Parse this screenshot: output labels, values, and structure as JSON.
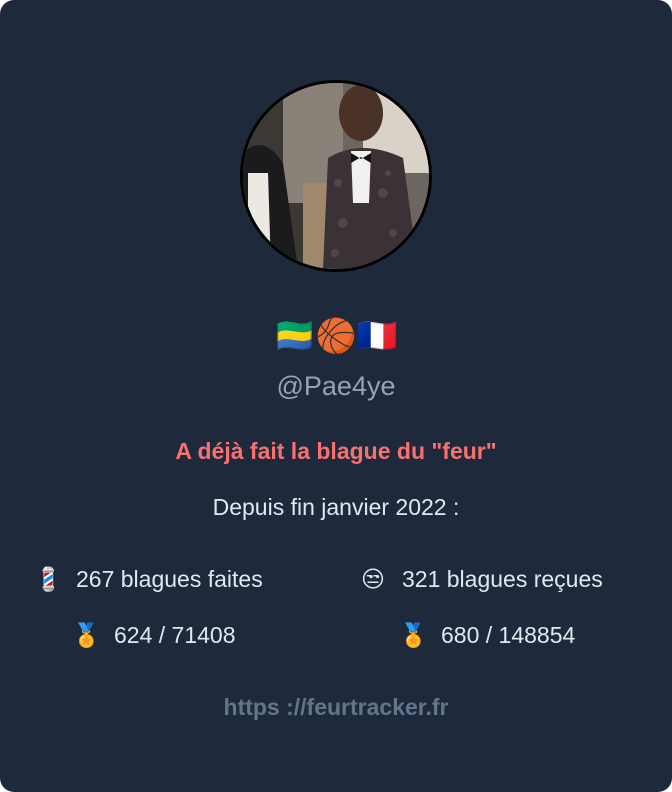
{
  "profile": {
    "emoji_flags": "🇬🇦🏀🇫🇷",
    "handle": "@Pae4ye",
    "tagline": "A déjà fait la blague du \"feur\"",
    "since_label": "Depuis fin janvier 2022 :"
  },
  "stats": {
    "made": {
      "icon": "💈",
      "icon_name": "barber-pole-icon",
      "label": "267 blagues faites"
    },
    "received": {
      "icon": "😒",
      "icon_name": "unamused-face-icon",
      "label": "321 blagues reçues"
    },
    "made_rank": {
      "icon": "🏅",
      "icon_name": "medal-icon",
      "label": "624 / 71408"
    },
    "received_rank": {
      "icon": "🏅",
      "icon_name": "medal-icon",
      "label": "680 / 148854"
    }
  },
  "footer": {
    "link_text": "https ://feurtracker.fr"
  },
  "colors": {
    "background": "#1e293b",
    "text": "#e2e8f0",
    "muted": "#94a3b8",
    "accent": "#f87171",
    "link": "#64748b"
  }
}
